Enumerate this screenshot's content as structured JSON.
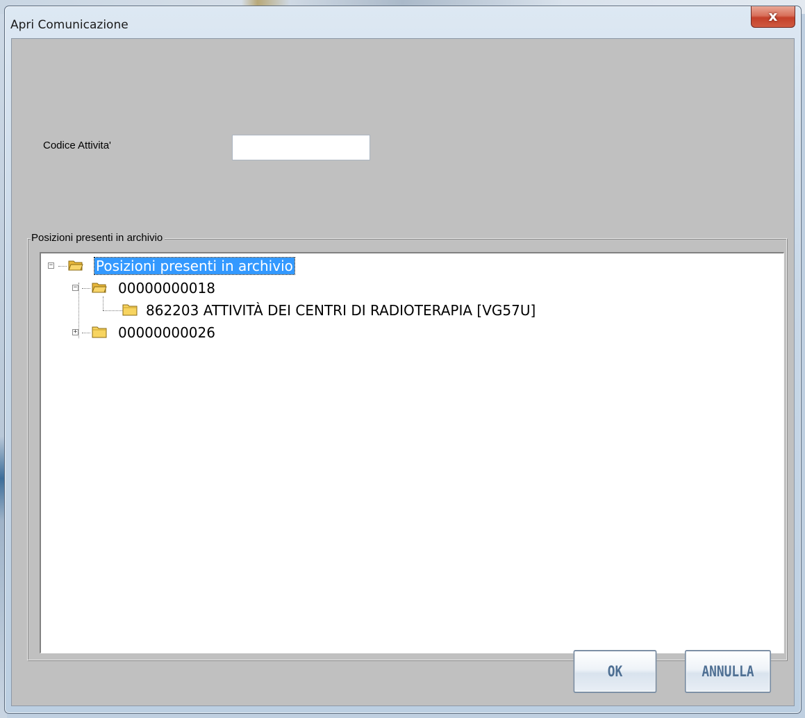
{
  "window": {
    "title": "Apri Comunicazione",
    "close_glyph": "x"
  },
  "form": {
    "codice_label": "Codice Attivita'",
    "codice_value": ""
  },
  "groupbox": {
    "legend": "Posizioni presenti in archivio"
  },
  "tree": {
    "root": {
      "label": "Posizioni presenti in archivio",
      "expanded": true,
      "selected": true
    },
    "nodes": [
      {
        "label": "00000000018",
        "expanded": true,
        "children": [
          {
            "label": "862203 ATTIVITÀ DEI CENTRI DI RADIOTERAPIA [VG57U]"
          }
        ]
      },
      {
        "label": "00000000026",
        "expanded": false,
        "children": []
      }
    ]
  },
  "buttons": {
    "ok": "OK",
    "cancel": "ANNULLA"
  },
  "colors": {
    "client_bg": "#c0c0c0",
    "selection": "#3399ff",
    "folder": "#f5c242",
    "button_text": "#4e6f93",
    "close_button": "#c4402a"
  },
  "icons": {
    "root": "folder-open-icon",
    "node_18": "folder-open-icon",
    "leaf": "folder-closed-icon",
    "node_26": "folder-closed-icon"
  }
}
